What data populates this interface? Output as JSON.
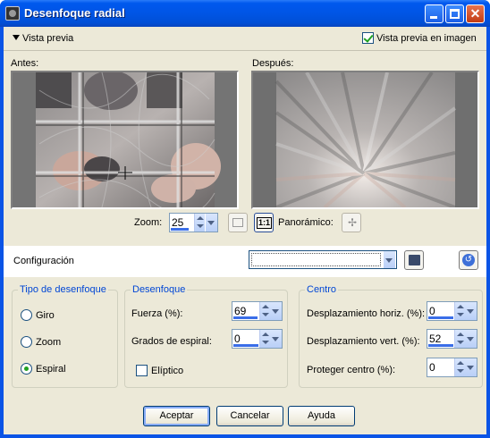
{
  "window": {
    "title": "Desenfoque radial"
  },
  "preview": {
    "toggle_label": "Vista previa",
    "in_image_label": "Vista previa en imagen",
    "in_image_checked": true,
    "before_label": "Antes:",
    "after_label": "Después:",
    "zoom_label": "Zoom:",
    "zoom_value": "25",
    "pan_label": "Panorámico:"
  },
  "config": {
    "label": "Configuración",
    "value": ""
  },
  "blur_type": {
    "title": "Tipo de desenfoque",
    "options": [
      "Giro",
      "Zoom",
      "Espiral"
    ],
    "selected": "Espiral"
  },
  "blur": {
    "title": "Desenfoque",
    "strength_label": "Fuerza (%):",
    "strength_value": "69",
    "strength_fraction": 0.69,
    "twist_label": "Grados de espiral:",
    "twist_value": "0",
    "elliptical_label": "Elíptico",
    "elliptical_checked": false
  },
  "center": {
    "title": "Centro",
    "horiz_label": "Desplazamiento horiz. (%):",
    "horiz_value": "0",
    "vert_label": "Desplazamiento vert. (%):",
    "vert_value": "52",
    "protect_label": "Proteger centro (%):",
    "protect_value": "0"
  },
  "buttons": {
    "ok": "Aceptar",
    "cancel": "Cancelar",
    "help": "Ayuda"
  },
  "colors": {
    "titlebar": "#0055e5",
    "face": "#ece9d8",
    "group_title": "#0046d5"
  }
}
